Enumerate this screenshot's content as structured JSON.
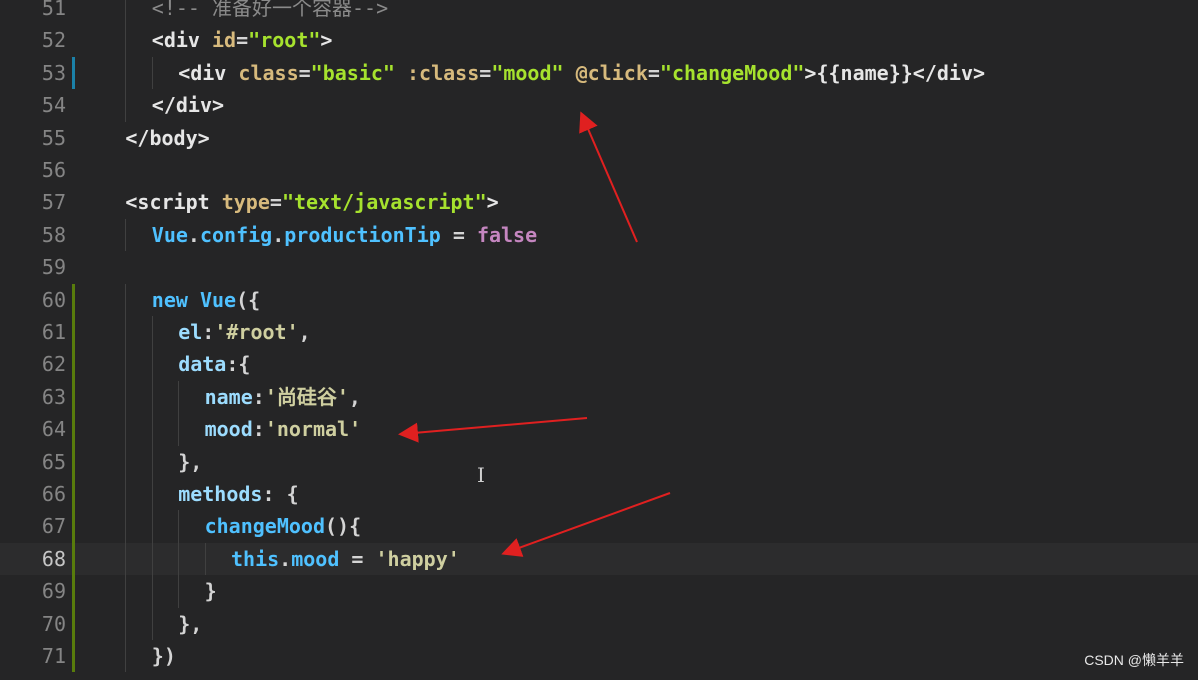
{
  "editor": {
    "current_line": 68,
    "lines": [
      {
        "num": "51",
        "tokens": [
          {
            "t": "<!-- 准备好一个容器-->",
            "c": "tok-comment"
          }
        ]
      },
      {
        "num": "52",
        "tokens": [
          {
            "t": "<div ",
            "c": "tok-tag"
          },
          {
            "t": "id",
            "c": "tok-attr"
          },
          {
            "t": "=",
            "c": "tok-punc"
          },
          {
            "t": "\"root\"",
            "c": "tok-str"
          },
          {
            "t": ">",
            "c": "tok-tag"
          }
        ]
      },
      {
        "num": "53",
        "tokens": [
          {
            "t": "<div ",
            "c": "tok-tag"
          },
          {
            "t": "class",
            "c": "tok-attr"
          },
          {
            "t": "=",
            "c": "tok-punc"
          },
          {
            "t": "\"basic\"",
            "c": "tok-str"
          },
          {
            "t": " ",
            "c": "tok-punc"
          },
          {
            "t": ":class",
            "c": "tok-attr"
          },
          {
            "t": "=",
            "c": "tok-punc"
          },
          {
            "t": "\"mood\"",
            "c": "tok-str"
          },
          {
            "t": " ",
            "c": "tok-punc"
          },
          {
            "t": "@click",
            "c": "tok-attr"
          },
          {
            "t": "=",
            "c": "tok-punc"
          },
          {
            "t": "\"changeMood\"",
            "c": "tok-str"
          },
          {
            "t": ">{{name}}</div>",
            "c": "tok-tag"
          }
        ]
      },
      {
        "num": "54",
        "tokens": [
          {
            "t": "</div>",
            "c": "tok-tag"
          }
        ]
      },
      {
        "num": "55",
        "tokens": [
          {
            "t": "</body>",
            "c": "tok-tag"
          }
        ]
      },
      {
        "num": "56",
        "tokens": []
      },
      {
        "num": "57",
        "tokens": [
          {
            "t": "<script ",
            "c": "tok-tag"
          },
          {
            "t": "type",
            "c": "tok-attr"
          },
          {
            "t": "=",
            "c": "tok-punc"
          },
          {
            "t": "\"text/javascript\"",
            "c": "tok-str"
          },
          {
            "t": ">",
            "c": "tok-tag"
          }
        ]
      },
      {
        "num": "58",
        "tokens": [
          {
            "t": "Vue",
            "c": "tok-kw"
          },
          {
            "t": ".",
            "c": "tok-punc"
          },
          {
            "t": "config",
            "c": "tok-kw"
          },
          {
            "t": ".",
            "c": "tok-punc"
          },
          {
            "t": "productionTip",
            "c": "tok-kw"
          },
          {
            "t": " = ",
            "c": "tok-punc"
          },
          {
            "t": "false",
            "c": "tok-bool"
          }
        ]
      },
      {
        "num": "59",
        "tokens": []
      },
      {
        "num": "60",
        "tokens": [
          {
            "t": "new ",
            "c": "tok-kw"
          },
          {
            "t": "Vue",
            "c": "tok-kw"
          },
          {
            "t": "({",
            "c": "tok-punc"
          }
        ]
      },
      {
        "num": "61",
        "tokens": [
          {
            "t": "el",
            "c": "tok-prop"
          },
          {
            "t": ":",
            "c": "tok-punc"
          },
          {
            "t": "'#root'",
            "c": "tok-str2"
          },
          {
            "t": ",",
            "c": "tok-punc"
          }
        ]
      },
      {
        "num": "62",
        "tokens": [
          {
            "t": "data",
            "c": "tok-prop"
          },
          {
            "t": ":{",
            "c": "tok-punc"
          }
        ]
      },
      {
        "num": "63",
        "tokens": [
          {
            "t": "name",
            "c": "tok-prop"
          },
          {
            "t": ":",
            "c": "tok-punc"
          },
          {
            "t": "'尚硅谷'",
            "c": "tok-str2"
          },
          {
            "t": ",",
            "c": "tok-punc"
          }
        ]
      },
      {
        "num": "64",
        "tokens": [
          {
            "t": "mood",
            "c": "tok-prop"
          },
          {
            "t": ":",
            "c": "tok-punc"
          },
          {
            "t": "'normal'",
            "c": "tok-str2"
          }
        ]
      },
      {
        "num": "65",
        "tokens": [
          {
            "t": "},",
            "c": "tok-punc"
          }
        ]
      },
      {
        "num": "66",
        "tokens": [
          {
            "t": "methods",
            "c": "tok-prop"
          },
          {
            "t": ": {",
            "c": "tok-punc"
          }
        ]
      },
      {
        "num": "67",
        "tokens": [
          {
            "t": "changeMood",
            "c": "tok-kw"
          },
          {
            "t": "(){",
            "c": "tok-punc"
          }
        ]
      },
      {
        "num": "68",
        "tokens": [
          {
            "t": "this",
            "c": "tok-kw"
          },
          {
            "t": ".",
            "c": "tok-punc"
          },
          {
            "t": "mood",
            "c": "tok-kw"
          },
          {
            "t": " = ",
            "c": "tok-punc"
          },
          {
            "t": "'happy'",
            "c": "tok-str2"
          }
        ]
      },
      {
        "num": "69",
        "tokens": [
          {
            "t": "}",
            "c": "tok-punc"
          }
        ]
      },
      {
        "num": "70",
        "tokens": [
          {
            "t": "},",
            "c": "tok-punc"
          }
        ]
      },
      {
        "num": "71",
        "tokens": [
          {
            "t": "})",
            "c": "tok-punc"
          }
        ]
      }
    ]
  },
  "cursor_glyph": "I",
  "watermark": "CSDN @懒羊羊",
  "colors": {
    "annotation_arrow": "#e02020",
    "git_modified": "#1b81a8",
    "git_added": "#587c0c"
  }
}
